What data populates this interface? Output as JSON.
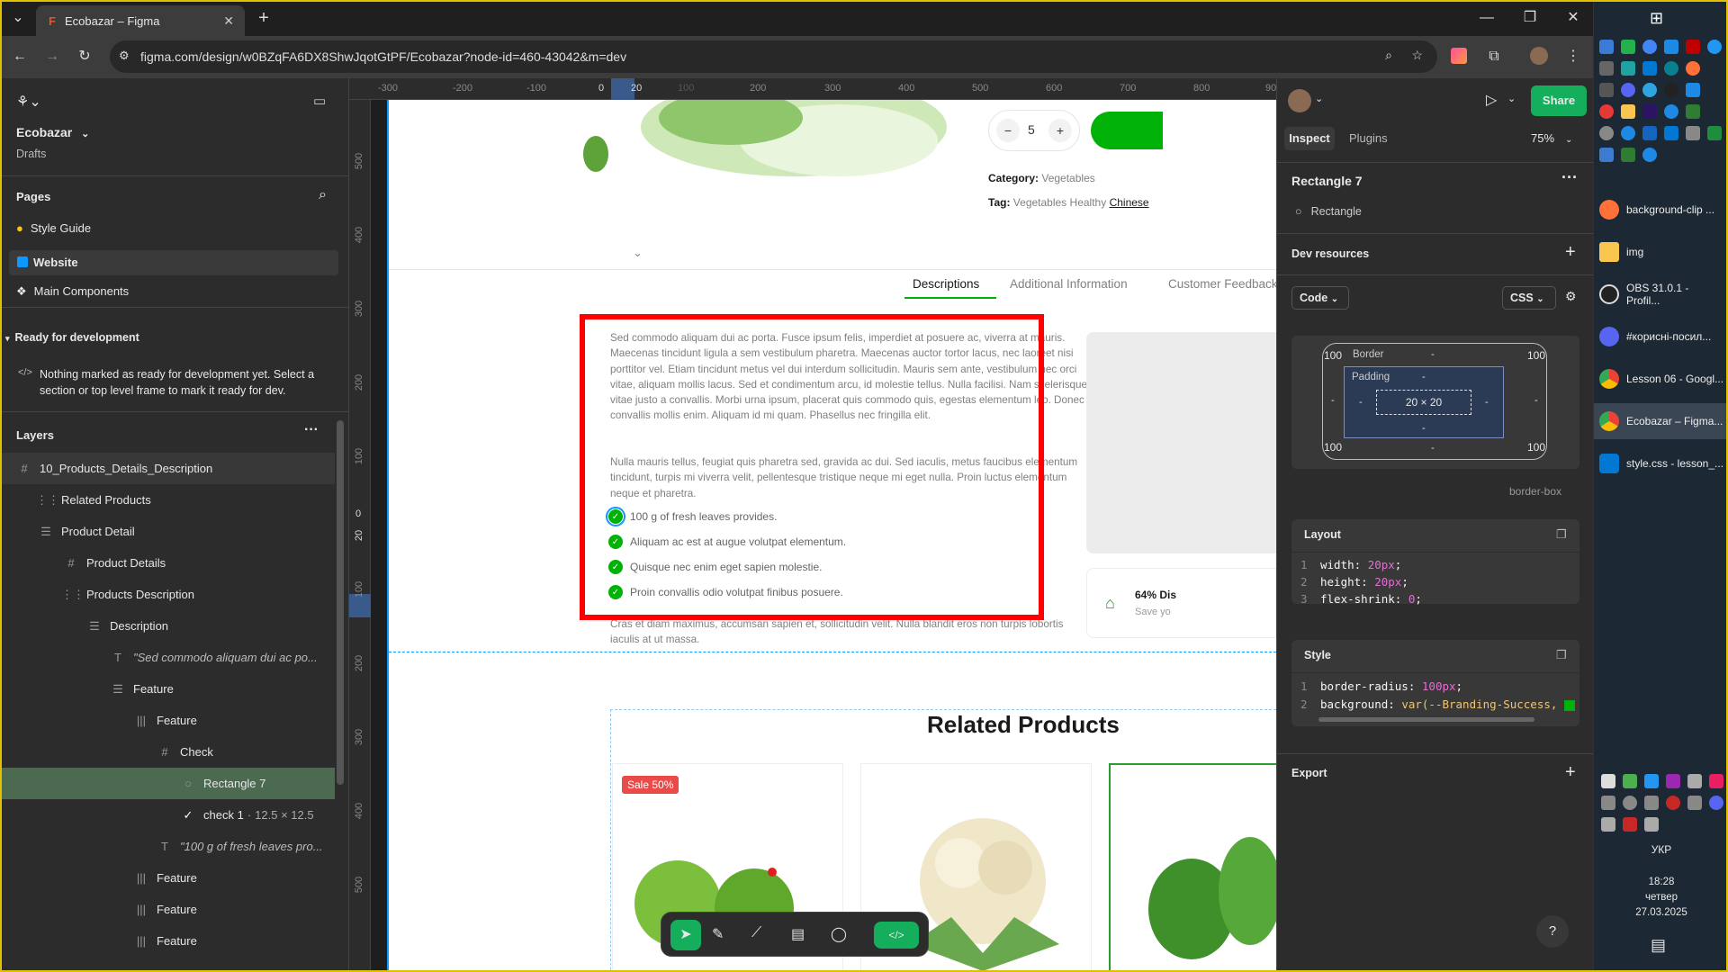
{
  "browser": {
    "tab_title": "Ecobazar – Figma",
    "url": "figma.com/design/w0BZqFA6DX8ShwJqotGtPF/Ecobazar?node-id=460-43042&m=dev"
  },
  "left_panel": {
    "file_name": "Ecobazar",
    "file_location": "Drafts",
    "pages_heading": "Pages",
    "pages": [
      "Style Guide",
      "Website",
      "Main Components"
    ],
    "ready_heading": "Ready for development",
    "ready_text": "Nothing marked as ready for development yet. Select a section or top level frame to mark it ready for dev.",
    "layers_heading": "Layers",
    "layers": [
      {
        "name": "10_Products_Details_Description",
        "icon": "frame-icon"
      },
      {
        "name": "Related Products",
        "icon": "section-icon"
      },
      {
        "name": "Product Detail",
        "icon": "stack-icon"
      },
      {
        "name": "Product Details",
        "icon": "frame-icon"
      },
      {
        "name": "Products Description",
        "icon": "section-icon"
      },
      {
        "name": "Description",
        "icon": "stack-icon"
      },
      {
        "name": "\"Sed commodo aliquam dui ac po...",
        "icon": "text-icon"
      },
      {
        "name": "Feature",
        "icon": "stack-icon"
      },
      {
        "name": "Feature",
        "icon": "columns-icon"
      },
      {
        "name": "Check",
        "icon": "frame-icon"
      },
      {
        "name": "Rectangle 7",
        "icon": "ellipse-icon"
      },
      {
        "name": "check 1",
        "meta": "12.5 × 12.5",
        "icon": "check-icon"
      },
      {
        "name": "\"100 g of fresh leaves pro...",
        "icon": "text-icon"
      },
      {
        "name": "Feature",
        "icon": "columns-icon"
      },
      {
        "name": "Feature",
        "icon": "columns-icon"
      },
      {
        "name": "Feature",
        "icon": "columns-icon"
      }
    ]
  },
  "rulers": {
    "top": [
      "-300",
      "-200",
      "-100",
      "0",
      "20",
      "100",
      "200",
      "300",
      "400",
      "500",
      "600",
      "700",
      "800",
      "900"
    ],
    "left": [
      "500",
      "400",
      "300",
      "200",
      "100",
      "0",
      "20",
      "100",
      "200",
      "300",
      "400",
      "500"
    ]
  },
  "design": {
    "quantity": "5",
    "category_label": "Category:",
    "category_value": "Vegetables",
    "tag_label": "Tag:",
    "tag_values": [
      "Vegetables",
      "Healthy",
      "Chinese"
    ],
    "tabs": [
      "Descriptions",
      "Additional Information",
      "Customer Feedback"
    ],
    "paragraph1": "Sed commodo aliquam dui ac porta. Fusce ipsum felis, imperdiet at posuere ac, viverra at mauris. Maecenas tincidunt ligula a sem vestibulum pharetra. Maecenas auctor tortor lacus, nec laoreet nisi porttitor vel. Etiam tincidunt metus vel dui interdum sollicitudin. Mauris sem ante, vestibulum nec orci vitae, aliquam mollis lacus. Sed et condimentum arcu, id molestie tellus. Nulla facilisi. Nam scelerisque vitae justo a convallis. Morbi urna ipsum, placerat quis commodo quis, egestas elementum leo. Donec convallis mollis enim. Aliquam id mi quam. Phasellus nec fringilla elit.",
    "paragraph2": "Nulla mauris tellus, feugiat quis pharetra sed, gravida ac dui. Sed iaculis, metus faucibus elementum tincidunt, turpis mi viverra velit, pellentesque tristique neque mi eget nulla. Proin luctus elementum neque et pharetra.",
    "features": [
      "100 g of fresh leaves provides.",
      "Aliquam ac est at augue volutpat elementum.",
      "Quisque nec enim eget sapien molestie.",
      "Proin convallis odio volutpat finibus posuere."
    ],
    "paragraph3": "Cras et diam maximus, accumsan sapien et, sollicitudin velit. Nulla blandit eros non turpis lobortis iaculis at ut massa.",
    "discount_title": "64% Dis",
    "discount_sub": "Save yo",
    "related_heading": "Related Products",
    "sale_badge": "Sale 50%"
  },
  "right_panel": {
    "tabs": [
      "Inspect",
      "Plugins"
    ],
    "zoom": "75%",
    "share": "Share",
    "selected_name": "Rectangle 7",
    "selected_type": "Rectangle",
    "dev_resources": "Dev resources",
    "code_select": "Code",
    "lang_select": "CSS",
    "box_model": {
      "border_label": "Border",
      "padding_label": "Padding",
      "size": "20 × 20",
      "radius_tl": "100",
      "radius_tr": "100",
      "radius_bl": "100",
      "radius_br": "100",
      "dash": "-",
      "sizing": "border-box"
    },
    "layout_heading": "Layout",
    "layout_lines": [
      {
        "n": "1",
        "prop": "width: ",
        "val": "20px",
        "end": ";"
      },
      {
        "n": "2",
        "prop": "height: ",
        "val": "20px",
        "end": ";"
      },
      {
        "n": "3",
        "prop": "flex-shrink: ",
        "val": "0",
        "end": ";"
      }
    ],
    "style_heading": "Style",
    "style_lines": [
      {
        "n": "1",
        "prop": "border-radius: ",
        "val": "100px",
        "end": ";"
      },
      {
        "n": "2",
        "prop": "background: ",
        "val": "var(--Branding-Success,",
        "end": ""
      }
    ],
    "export_heading": "Export",
    "help": "?"
  },
  "taskbar": {
    "items": [
      "background-clip ...",
      "img",
      "OBS 31.0.1 - Profil...",
      "#корисні-посил...",
      "Lesson 06 - Googl...",
      "Ecobazar – Figma...",
      "style.css - lesson_..."
    ],
    "lang": "УКР",
    "time": "18:28",
    "day": "четвер",
    "date": "27.03.2025"
  },
  "colors": {
    "accent_green": "#00b207",
    "highlight_red": "#ff0000",
    "figma_selection": "#0d99ff",
    "share_green": "#14ae5c"
  }
}
